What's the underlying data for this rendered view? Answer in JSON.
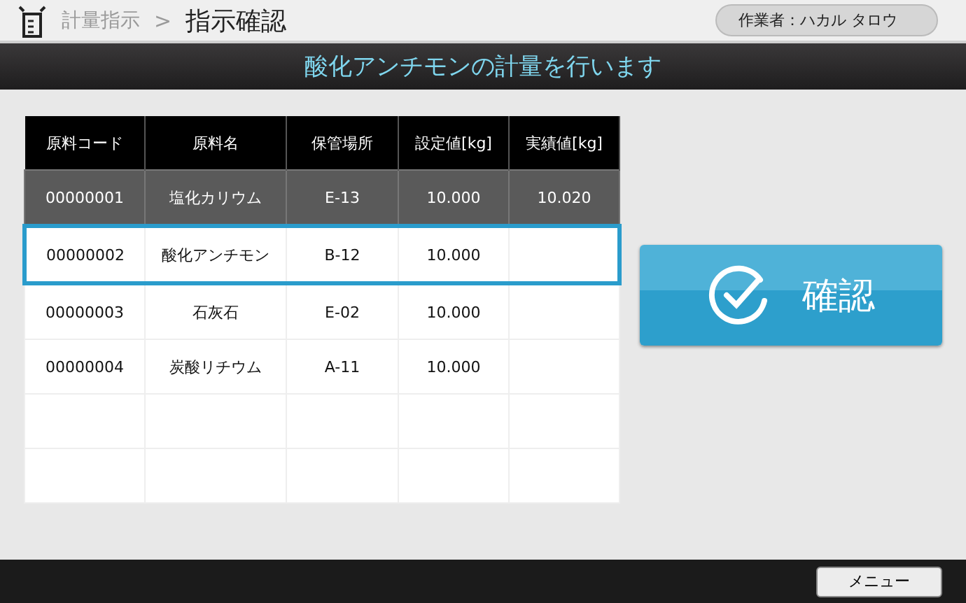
{
  "breadcrumb": {
    "parent": "計量指示",
    "separator": ">",
    "current": "指示確認"
  },
  "operator": "作業者：ハカル タロウ",
  "banner": "酸化アンチモンの計量を行います",
  "table": {
    "columns": [
      "原料コード",
      "原料名",
      "保管場所",
      "設定値[kg]",
      "実績値[kg]"
    ],
    "rows": [
      {
        "cells": [
          "00000001",
          "塩化カリウム",
          "E-13",
          "10.000",
          "10.020"
        ],
        "done": true,
        "selected": false
      },
      {
        "cells": [
          "00000002",
          "酸化アンチモン",
          "B-12",
          "10.000",
          ""
        ],
        "done": false,
        "selected": true
      },
      {
        "cells": [
          "00000003",
          "石灰石",
          "E-02",
          "10.000",
          ""
        ],
        "done": false,
        "selected": false
      },
      {
        "cells": [
          "00000004",
          "炭酸リチウム",
          "A-11",
          "10.000",
          ""
        ],
        "done": false,
        "selected": false
      }
    ]
  },
  "confirm_button": "確認",
  "menu_button": "メニュー"
}
